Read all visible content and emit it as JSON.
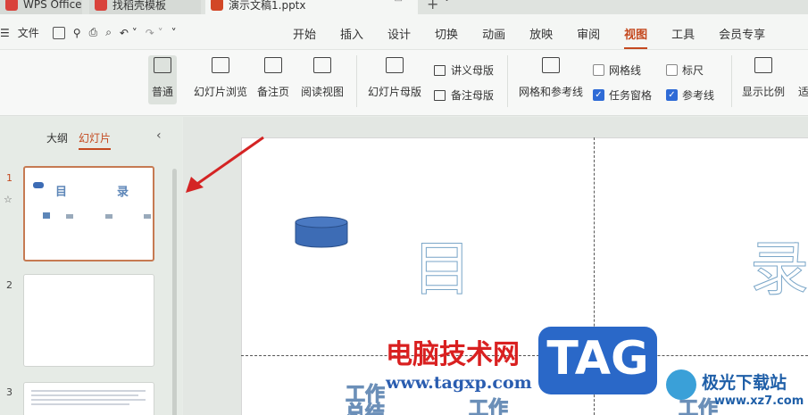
{
  "tabs": [
    {
      "label": "WPS Office",
      "icon": "wps-icon"
    },
    {
      "label": "找稻壳模板",
      "icon": "pdf-icon"
    },
    {
      "label": "演示文稿1.pptx",
      "icon": "ppt-icon"
    }
  ],
  "menu": {
    "file_label": "文件",
    "tabs": [
      "开始",
      "插入",
      "设计",
      "切换",
      "动画",
      "放映",
      "审阅",
      "视图",
      "工具",
      "会员专享"
    ],
    "active_tab": "视图"
  },
  "ribbon": {
    "normal": "普通",
    "slide_browse": "幻灯片浏览",
    "notes_page": "备注页",
    "reading_view": "阅读视图",
    "slide_master": "幻灯片母版",
    "handout_master": "讲义母版",
    "notes_master": "备注母版",
    "grid_guides": "网格和参考线",
    "gridlines": "网格线",
    "task_pane": "任务窗格",
    "ruler": "标尺",
    "guides": "参考线",
    "zoom": "显示比例",
    "fit": "适"
  },
  "pane": {
    "outline_tab": "大纲",
    "slides_tab": "幻灯片",
    "slide_numbers": [
      "1",
      "2",
      "3"
    ]
  },
  "slide": {
    "title_left": "目",
    "title_right": "录",
    "item1a": "工作",
    "item1b": "总结",
    "item2a": "工作",
    "item3a": "工作"
  },
  "thumb1": {
    "a": "目",
    "b": "录"
  },
  "watermark": {
    "site_name": "电脑技术网",
    "url": "www.tagxp.com",
    "tag": "TAG",
    "right_name": "极光下载站",
    "right_url": "www.xz7.com"
  }
}
